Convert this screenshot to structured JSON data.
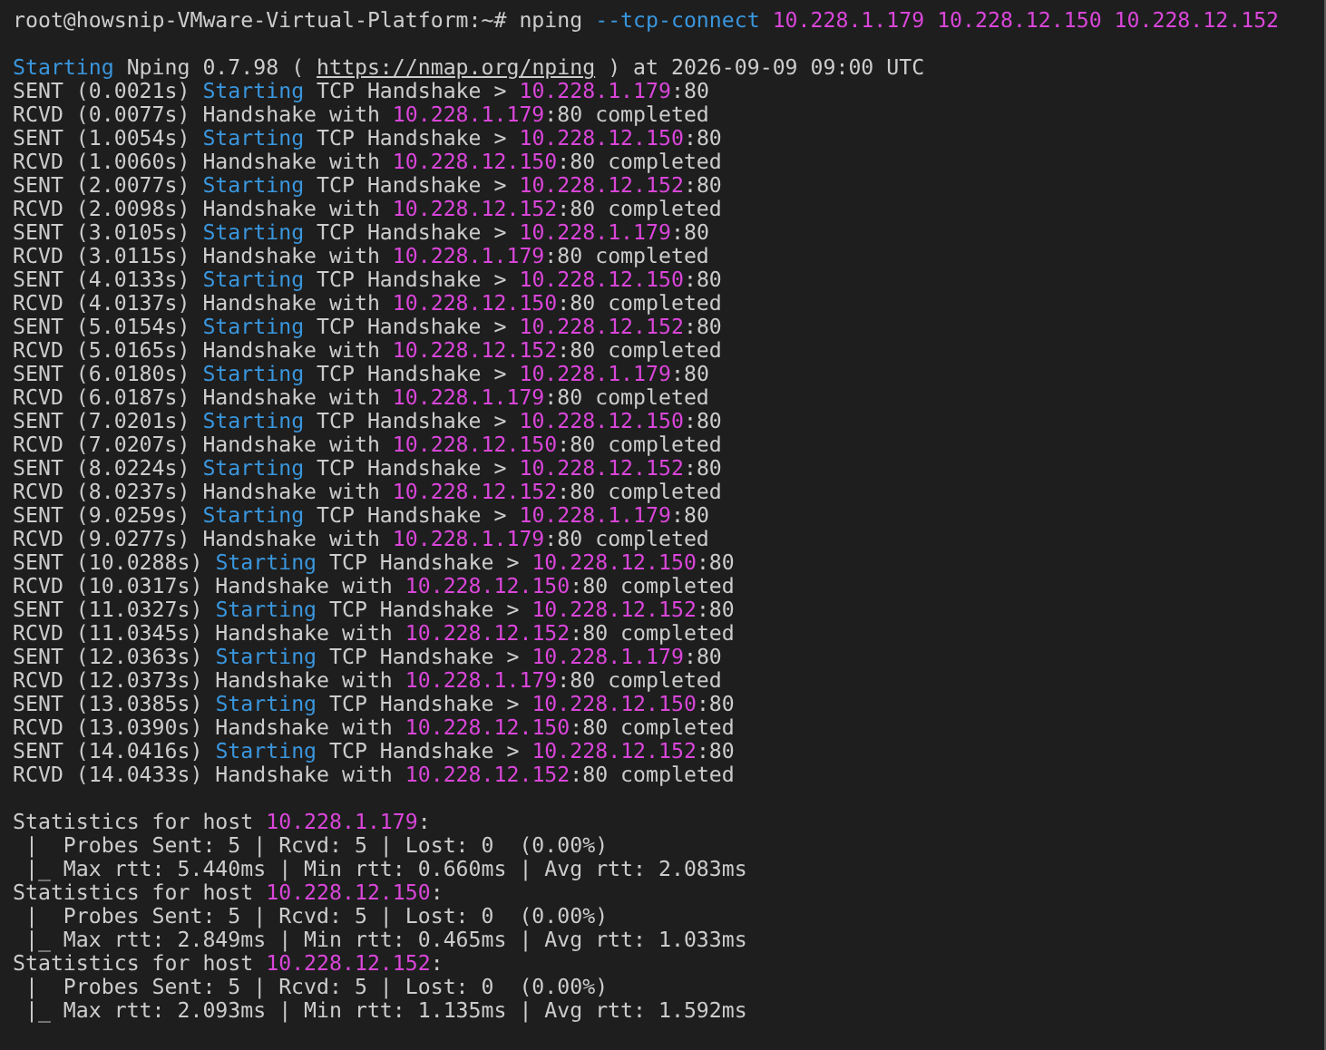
{
  "terminal": {
    "blocks": [
      {
        "lines": [
          [
            {
              "text": "root@howsnip-VMware-Virtual-Platform:~# nping ",
              "kind": "text"
            },
            {
              "text": "--tcp-connect",
              "kind": "keyword"
            },
            {
              "text": " 10.228.1.179 10.228.12.150 10.228.12.152",
              "kind": "address"
            }
          ]
        ]
      },
      {
        "lines": [
          [
            {
              "text": "Starting",
              "kind": "keyword"
            },
            {
              "text": " Nping 0.7.98 ( ",
              "kind": "text"
            },
            {
              "text": "https://nmap.org/nping",
              "kind": "link"
            },
            {
              "text": " ) at 2026-09-09 09:00 UTC",
              "kind": "text"
            }
          ],
          [
            {
              "text": "SENT (0.0021s) ",
              "kind": "text"
            },
            {
              "text": "Starting",
              "kind": "keyword"
            },
            {
              "text": " TCP Handshake > ",
              "kind": "text"
            },
            {
              "text": "10.228.1.179",
              "kind": "address"
            },
            {
              "text": ":80",
              "kind": "text"
            }
          ],
          [
            {
              "text": "RCVD (0.0077s) Handshake with ",
              "kind": "text"
            },
            {
              "text": "10.228.1.179",
              "kind": "address"
            },
            {
              "text": ":80 completed",
              "kind": "text"
            }
          ],
          [
            {
              "text": "SENT (1.0054s) ",
              "kind": "text"
            },
            {
              "text": "Starting",
              "kind": "keyword"
            },
            {
              "text": " TCP Handshake > ",
              "kind": "text"
            },
            {
              "text": "10.228.12.150",
              "kind": "address"
            },
            {
              "text": ":80",
              "kind": "text"
            }
          ],
          [
            {
              "text": "RCVD (1.0060s) Handshake with ",
              "kind": "text"
            },
            {
              "text": "10.228.12.150",
              "kind": "address"
            },
            {
              "text": ":80 completed",
              "kind": "text"
            }
          ],
          [
            {
              "text": "SENT (2.0077s) ",
              "kind": "text"
            },
            {
              "text": "Starting",
              "kind": "keyword"
            },
            {
              "text": " TCP Handshake > ",
              "kind": "text"
            },
            {
              "text": "10.228.12.152",
              "kind": "address"
            },
            {
              "text": ":80",
              "kind": "text"
            }
          ],
          [
            {
              "text": "RCVD (2.0098s) Handshake with ",
              "kind": "text"
            },
            {
              "text": "10.228.12.152",
              "kind": "address"
            },
            {
              "text": ":80 completed",
              "kind": "text"
            }
          ],
          [
            {
              "text": "SENT (3.0105s) ",
              "kind": "text"
            },
            {
              "text": "Starting",
              "kind": "keyword"
            },
            {
              "text": " TCP Handshake > ",
              "kind": "text"
            },
            {
              "text": "10.228.1.179",
              "kind": "address"
            },
            {
              "text": ":80",
              "kind": "text"
            }
          ],
          [
            {
              "text": "RCVD (3.0115s) Handshake with ",
              "kind": "text"
            },
            {
              "text": "10.228.1.179",
              "kind": "address"
            },
            {
              "text": ":80 completed",
              "kind": "text"
            }
          ],
          [
            {
              "text": "SENT (4.0133s) ",
              "kind": "text"
            },
            {
              "text": "Starting",
              "kind": "keyword"
            },
            {
              "text": " TCP Handshake > ",
              "kind": "text"
            },
            {
              "text": "10.228.12.150",
              "kind": "address"
            },
            {
              "text": ":80",
              "kind": "text"
            }
          ],
          [
            {
              "text": "RCVD (4.0137s) Handshake with ",
              "kind": "text"
            },
            {
              "text": "10.228.12.150",
              "kind": "address"
            },
            {
              "text": ":80 completed",
              "kind": "text"
            }
          ],
          [
            {
              "text": "SENT (5.0154s) ",
              "kind": "text"
            },
            {
              "text": "Starting",
              "kind": "keyword"
            },
            {
              "text": " TCP Handshake > ",
              "kind": "text"
            },
            {
              "text": "10.228.12.152",
              "kind": "address"
            },
            {
              "text": ":80",
              "kind": "text"
            }
          ],
          [
            {
              "text": "RCVD (5.0165s) Handshake with ",
              "kind": "text"
            },
            {
              "text": "10.228.12.152",
              "kind": "address"
            },
            {
              "text": ":80 completed",
              "kind": "text"
            }
          ],
          [
            {
              "text": "SENT (6.0180s) ",
              "kind": "text"
            },
            {
              "text": "Starting",
              "kind": "keyword"
            },
            {
              "text": " TCP Handshake > ",
              "kind": "text"
            },
            {
              "text": "10.228.1.179",
              "kind": "address"
            },
            {
              "text": ":80",
              "kind": "text"
            }
          ],
          [
            {
              "text": "RCVD (6.0187s) Handshake with ",
              "kind": "text"
            },
            {
              "text": "10.228.1.179",
              "kind": "address"
            },
            {
              "text": ":80 completed",
              "kind": "text"
            }
          ],
          [
            {
              "text": "SENT (7.0201s) ",
              "kind": "text"
            },
            {
              "text": "Starting",
              "kind": "keyword"
            },
            {
              "text": " TCP Handshake > ",
              "kind": "text"
            },
            {
              "text": "10.228.12.150",
              "kind": "address"
            },
            {
              "text": ":80",
              "kind": "text"
            }
          ],
          [
            {
              "text": "RCVD (7.0207s) Handshake with ",
              "kind": "text"
            },
            {
              "text": "10.228.12.150",
              "kind": "address"
            },
            {
              "text": ":80 completed",
              "kind": "text"
            }
          ],
          [
            {
              "text": "SENT (8.0224s) ",
              "kind": "text"
            },
            {
              "text": "Starting",
              "kind": "keyword"
            },
            {
              "text": " TCP Handshake > ",
              "kind": "text"
            },
            {
              "text": "10.228.12.152",
              "kind": "address"
            },
            {
              "text": ":80",
              "kind": "text"
            }
          ],
          [
            {
              "text": "RCVD (8.0237s) Handshake with ",
              "kind": "text"
            },
            {
              "text": "10.228.12.152",
              "kind": "address"
            },
            {
              "text": ":80 completed",
              "kind": "text"
            }
          ],
          [
            {
              "text": "SENT (9.0259s) ",
              "kind": "text"
            },
            {
              "text": "Starting",
              "kind": "keyword"
            },
            {
              "text": " TCP Handshake > ",
              "kind": "text"
            },
            {
              "text": "10.228.1.179",
              "kind": "address"
            },
            {
              "text": ":80",
              "kind": "text"
            }
          ],
          [
            {
              "text": "RCVD (9.0277s) Handshake with ",
              "kind": "text"
            },
            {
              "text": "10.228.1.179",
              "kind": "address"
            },
            {
              "text": ":80 completed",
              "kind": "text"
            }
          ],
          [
            {
              "text": "SENT (10.0288s) ",
              "kind": "text"
            },
            {
              "text": "Starting",
              "kind": "keyword"
            },
            {
              "text": " TCP Handshake > ",
              "kind": "text"
            },
            {
              "text": "10.228.12.150",
              "kind": "address"
            },
            {
              "text": ":80",
              "kind": "text"
            }
          ],
          [
            {
              "text": "RCVD (10.0317s) Handshake with ",
              "kind": "text"
            },
            {
              "text": "10.228.12.150",
              "kind": "address"
            },
            {
              "text": ":80 completed",
              "kind": "text"
            }
          ],
          [
            {
              "text": "SENT (11.0327s) ",
              "kind": "text"
            },
            {
              "text": "Starting",
              "kind": "keyword"
            },
            {
              "text": " TCP Handshake > ",
              "kind": "text"
            },
            {
              "text": "10.228.12.152",
              "kind": "address"
            },
            {
              "text": ":80",
              "kind": "text"
            }
          ],
          [
            {
              "text": "RCVD (11.0345s) Handshake with ",
              "kind": "text"
            },
            {
              "text": "10.228.12.152",
              "kind": "address"
            },
            {
              "text": ":80 completed",
              "kind": "text"
            }
          ],
          [
            {
              "text": "SENT (12.0363s) ",
              "kind": "text"
            },
            {
              "text": "Starting",
              "kind": "keyword"
            },
            {
              "text": " TCP Handshake > ",
              "kind": "text"
            },
            {
              "text": "10.228.1.179",
              "kind": "address"
            },
            {
              "text": ":80",
              "kind": "text"
            }
          ],
          [
            {
              "text": "RCVD (12.0373s) Handshake with ",
              "kind": "text"
            },
            {
              "text": "10.228.1.179",
              "kind": "address"
            },
            {
              "text": ":80 completed",
              "kind": "text"
            }
          ],
          [
            {
              "text": "SENT (13.0385s) ",
              "kind": "text"
            },
            {
              "text": "Starting",
              "kind": "keyword"
            },
            {
              "text": " TCP Handshake > ",
              "kind": "text"
            },
            {
              "text": "10.228.12.150",
              "kind": "address"
            },
            {
              "text": ":80",
              "kind": "text"
            }
          ],
          [
            {
              "text": "RCVD (13.0390s) Handshake with ",
              "kind": "text"
            },
            {
              "text": "10.228.12.150",
              "kind": "address"
            },
            {
              "text": ":80 completed",
              "kind": "text"
            }
          ],
          [
            {
              "text": "SENT (14.0416s) ",
              "kind": "text"
            },
            {
              "text": "Starting",
              "kind": "keyword"
            },
            {
              "text": " TCP Handshake > ",
              "kind": "text"
            },
            {
              "text": "10.228.12.152",
              "kind": "address"
            },
            {
              "text": ":80",
              "kind": "text"
            }
          ],
          [
            {
              "text": "RCVD (14.0433s) Handshake with ",
              "kind": "text"
            },
            {
              "text": "10.228.12.152",
              "kind": "address"
            },
            {
              "text": ":80 completed",
              "kind": "text"
            }
          ]
        ]
      },
      {
        "lines": [
          [
            {
              "text": "Statistics for host ",
              "kind": "text"
            },
            {
              "text": "10.228.1.179",
              "kind": "address"
            },
            {
              "text": ":",
              "kind": "text"
            }
          ],
          [
            {
              "text": " |  Probes Sent: 5 | Rcvd: 5 | Lost: 0  (0.00%)",
              "kind": "text"
            }
          ],
          [
            {
              "text": " |_ Max rtt: 5.440ms | Min rtt: 0.660ms | Avg rtt: 2.083ms",
              "kind": "text"
            }
          ],
          [
            {
              "text": "Statistics for host ",
              "kind": "text"
            },
            {
              "text": "10.228.12.150",
              "kind": "address"
            },
            {
              "text": ":",
              "kind": "text"
            }
          ],
          [
            {
              "text": " |  Probes Sent: 5 | Rcvd: 5 | Lost: 0  (0.00%)",
              "kind": "text"
            }
          ],
          [
            {
              "text": " |_ Max rtt: 2.849ms | Min rtt: 0.465ms | Avg rtt: 1.033ms",
              "kind": "text"
            }
          ],
          [
            {
              "text": "Statistics for host ",
              "kind": "text"
            },
            {
              "text": "10.228.12.152",
              "kind": "address"
            },
            {
              "text": ":",
              "kind": "text"
            }
          ],
          [
            {
              "text": " |  Probes Sent: 5 | Rcvd: 5 | Lost: 0  (0.00%)",
              "kind": "text"
            }
          ],
          [
            {
              "text": " |_ Max rtt: 2.093ms | Min rtt: 1.135ms | Avg rtt: 1.592ms",
              "kind": "text"
            }
          ]
        ]
      }
    ]
  }
}
